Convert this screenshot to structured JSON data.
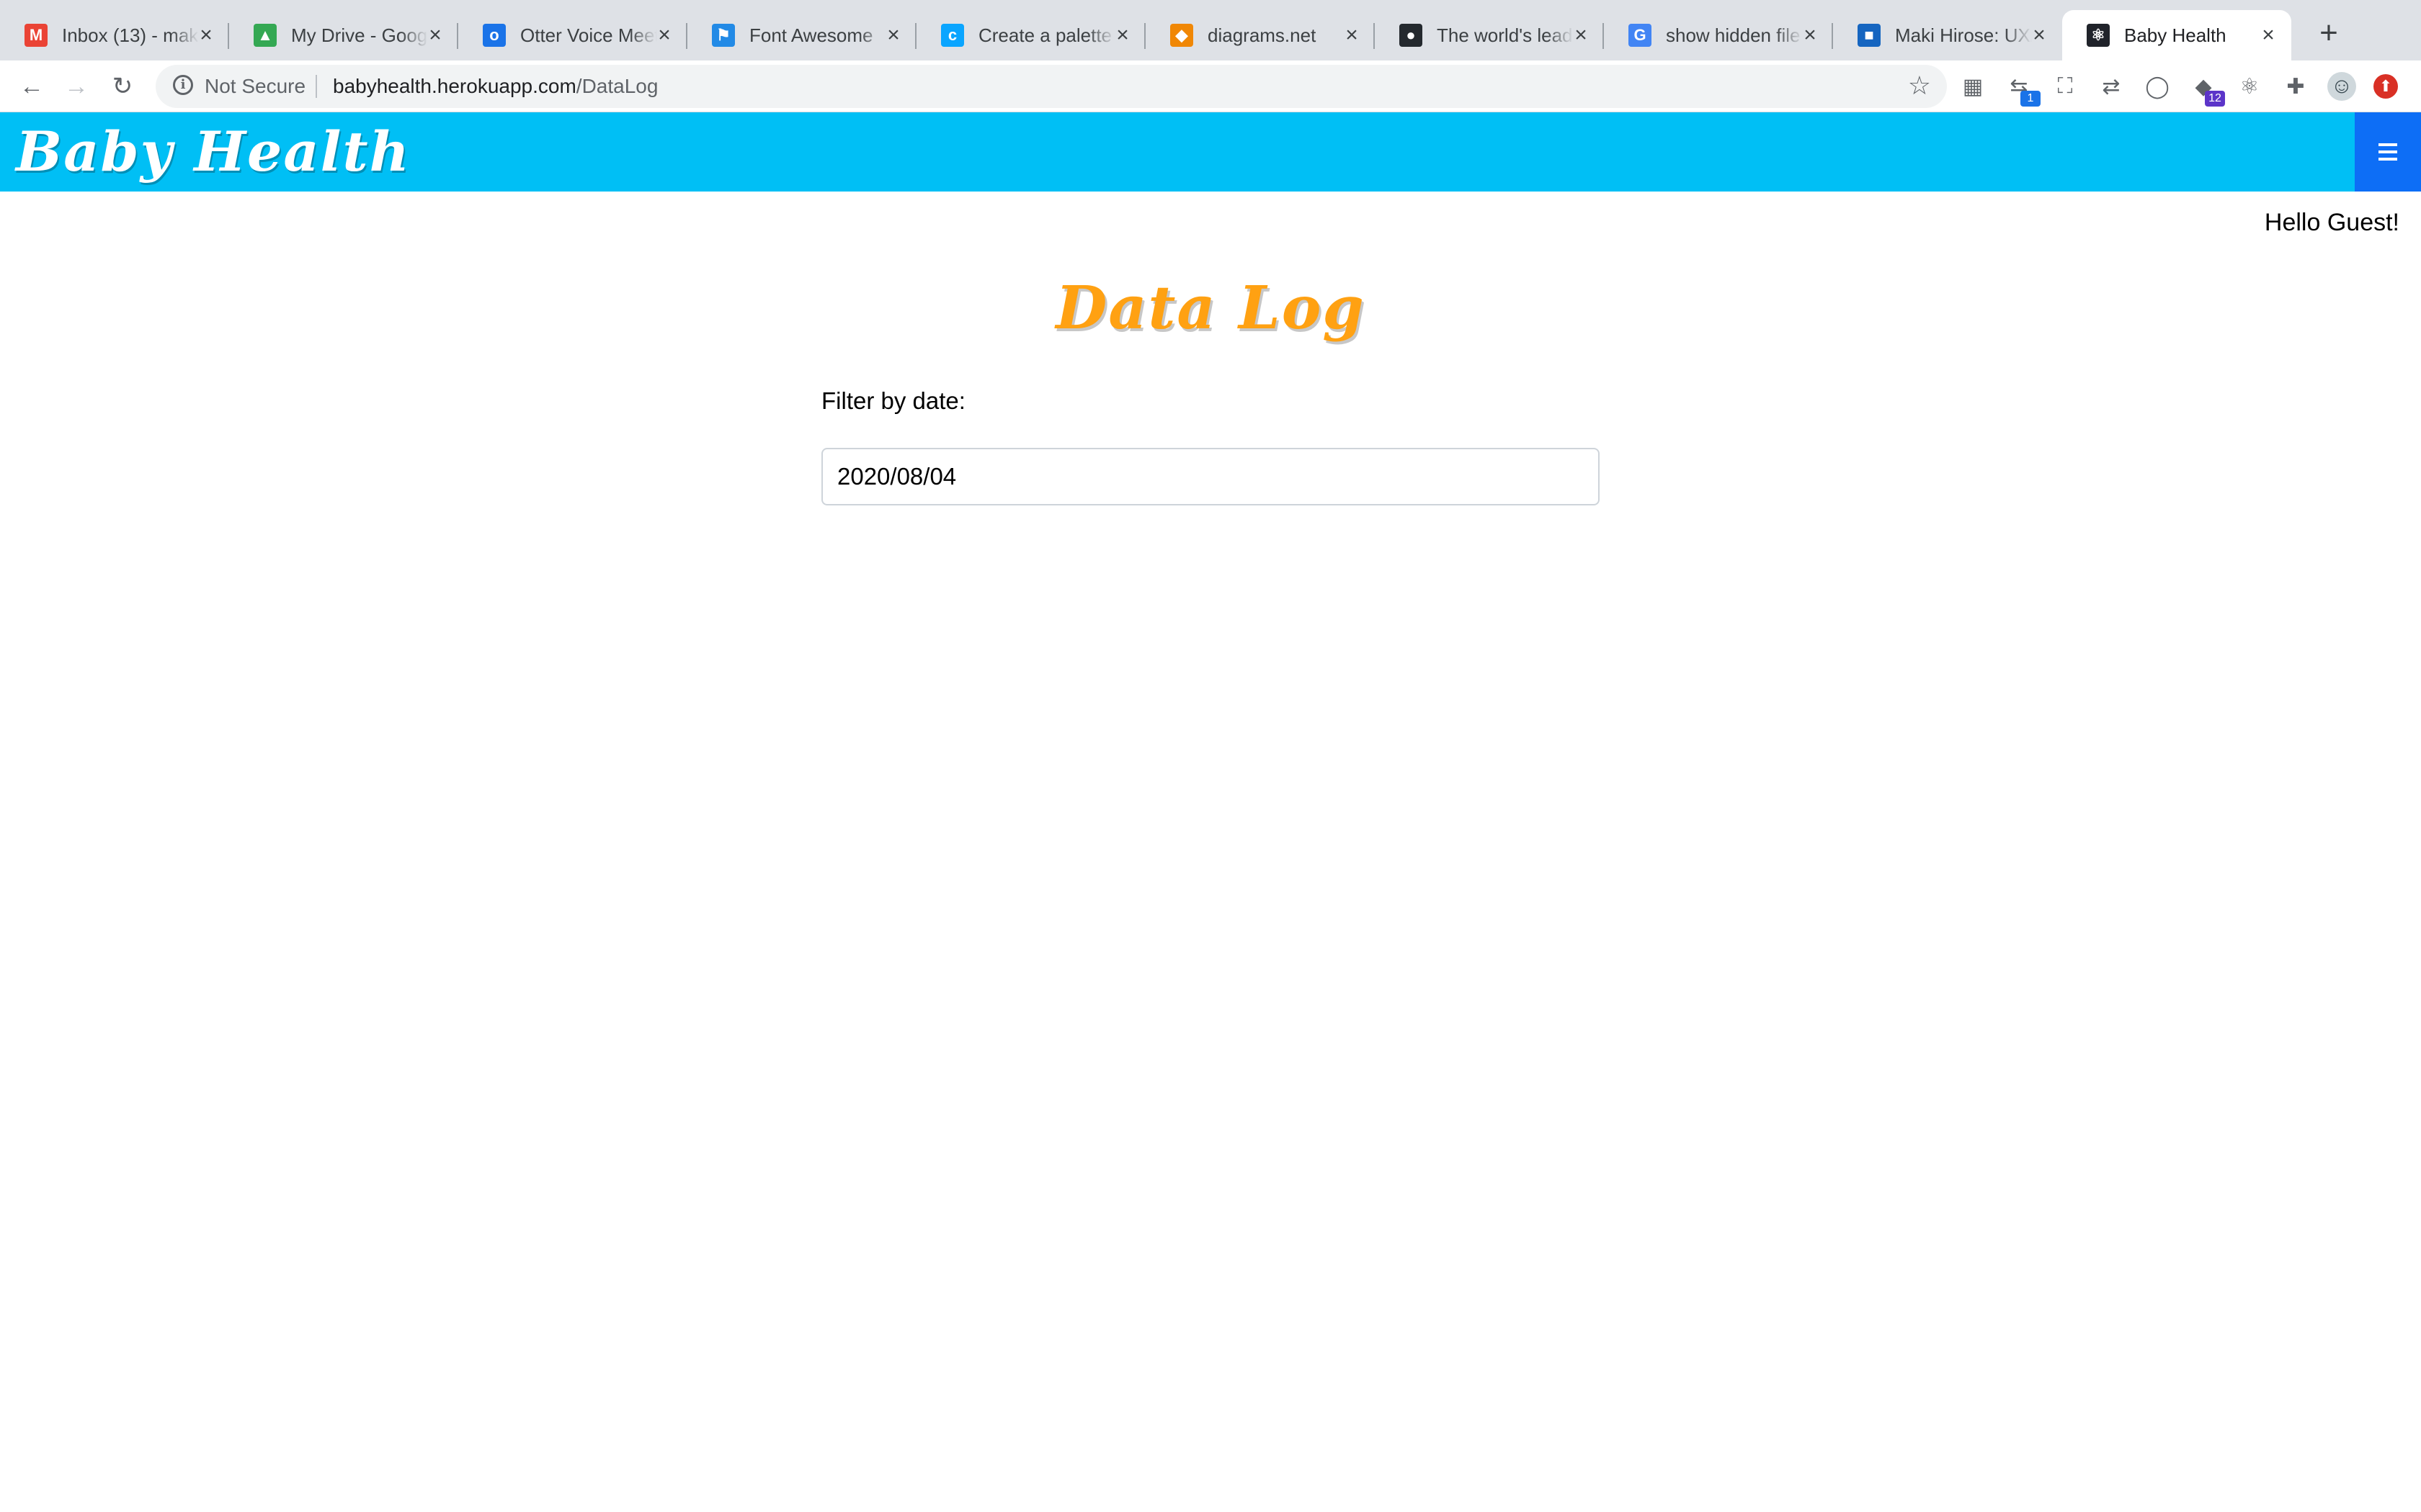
{
  "browser": {
    "tabs": [
      {
        "title": "Inbox (13) - maki",
        "favicon": "gmail-icon",
        "color": "#ea4335",
        "glyph": "M"
      },
      {
        "title": "My Drive - Google",
        "favicon": "google-drive-icon",
        "color": "#34a853",
        "glyph": "▲"
      },
      {
        "title": "Otter Voice Meet",
        "favicon": "otter-icon",
        "color": "#1a73e8",
        "glyph": "o"
      },
      {
        "title": "Font Awesome",
        "favicon": "font-awesome-flag-icon",
        "color": "#228ae6",
        "glyph": "⚑"
      },
      {
        "title": "Create a palette",
        "favicon": "coolors-icon",
        "color": "#0aa5ff",
        "glyph": "c"
      },
      {
        "title": "diagrams.net",
        "favicon": "diagrams-icon",
        "color": "#f08705",
        "glyph": "◆"
      },
      {
        "title": "The world's lead",
        "favicon": "github-icon",
        "color": "#24292e",
        "glyph": "●"
      },
      {
        "title": "show hidden file",
        "favicon": "google-icon",
        "color": "#4285f4",
        "glyph": "G"
      },
      {
        "title": "Maki Hirose: UX/",
        "favicon": "portfolio-icon",
        "color": "#1565c0",
        "glyph": "■"
      },
      {
        "title": "Baby Health",
        "favicon": "react-icon",
        "color": "#20232a",
        "glyph": "⚛"
      }
    ],
    "active_tab_index": 9,
    "new_tab_symbol": "+",
    "close_symbol": "×",
    "address": {
      "security_label": "Not Secure",
      "url_host": "babyhealth.herokuapp.com",
      "url_path": "/DataLog"
    },
    "extensions": [
      {
        "name": "extension-tile-icon",
        "glyph": "▦",
        "badge": ""
      },
      {
        "name": "extension-share-icon",
        "glyph": "⇆",
        "badge": "1",
        "badge_color": "#1a73e8"
      },
      {
        "name": "screenshot-frame-icon",
        "glyph": "⛶",
        "badge": ""
      },
      {
        "name": "extension-arrows-icon",
        "glyph": "⇄",
        "badge": ""
      },
      {
        "name": "extension-circle-icon",
        "glyph": "◯",
        "badge": ""
      },
      {
        "name": "extension-graduation-icon",
        "glyph": "◆",
        "badge": "12",
        "badge_color": "#5c35c9"
      },
      {
        "name": "react-devtools-icon",
        "glyph": "⚛",
        "badge": ""
      },
      {
        "name": "extensions-puzzle-icon",
        "glyph": "✚",
        "badge": ""
      },
      {
        "name": "profile-avatar-icon",
        "glyph": "☺",
        "badge": ""
      },
      {
        "name": "update-arrow-icon",
        "glyph": "⬆",
        "badge": ""
      }
    ]
  },
  "app": {
    "brand": "Baby Health",
    "greeting": "Hello Guest!",
    "page_title": "Data Log",
    "filter_label": "Filter by date:",
    "filter_value": "2020/08/04",
    "colors": {
      "navbar": "#00bff5",
      "menu_button": "#0d6ef6",
      "title": "#ffa112"
    }
  }
}
